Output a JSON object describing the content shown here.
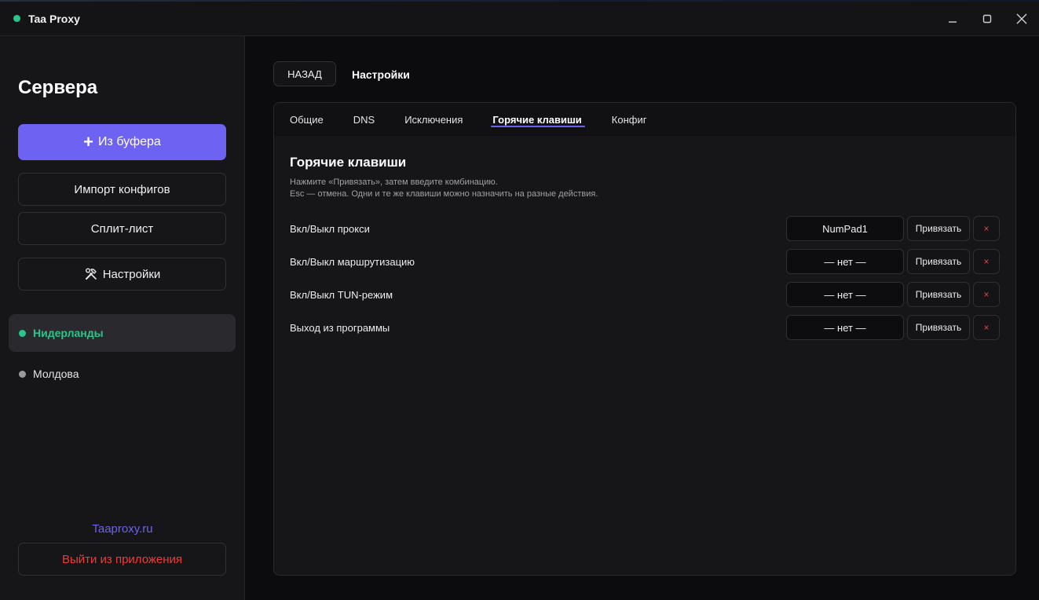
{
  "window": {
    "title": "Taa Proxy",
    "status_color": "#2bc48a",
    "controls": [
      "minimize-icon",
      "maximize-icon",
      "close-icon"
    ]
  },
  "sidebar": {
    "heading": "Сервера",
    "buttons": {
      "from_clipboard": "Из буфера",
      "import_configs": "Импорт конфигов",
      "split_list": "Сплит-лист",
      "settings": "Настройки"
    },
    "servers": [
      {
        "name": "Нидерланды",
        "active": true,
        "dot_color": "#2bc48a"
      },
      {
        "name": "Молдова",
        "active": false,
        "dot_color": "#9a9aa0"
      }
    ],
    "site_link": "Taaproxy.ru",
    "logout": "Выйти из приложения"
  },
  "main": {
    "back_label": "НАЗАД",
    "page_title": "Настройки",
    "tabs": [
      {
        "label": "Общие",
        "active": false
      },
      {
        "label": "DNS",
        "active": false
      },
      {
        "label": "Исключения",
        "active": false
      },
      {
        "label": "Горячие клавиши",
        "active": true
      },
      {
        "label": "Конфиг",
        "active": false
      }
    ],
    "section": {
      "title": "Горячие клавиши",
      "desc_line1": "Нажмите «Привязать», затем введите комбинацию.",
      "desc_line2": "Esc — отмена. Одни и те же клавиши можно назначить на разные действия."
    },
    "hotkeys": [
      {
        "label": "Вкл/Выкл прокси",
        "key": "NumPad1",
        "bind": "Привязать",
        "clear": "×"
      },
      {
        "label": "Вкл/Выкл маршрутизацию",
        "key": "— нет —",
        "bind": "Привязать",
        "clear": "×"
      },
      {
        "label": "Вкл/Выкл TUN-режим",
        "key": "— нет —",
        "bind": "Привязать",
        "clear": "×"
      },
      {
        "label": "Выход из программы",
        "key": "— нет —",
        "bind": "Привязать",
        "clear": "×"
      }
    ]
  },
  "colors": {
    "accent": "#6e62f2",
    "danger": "#ef3b3b",
    "online": "#2bc48a"
  }
}
